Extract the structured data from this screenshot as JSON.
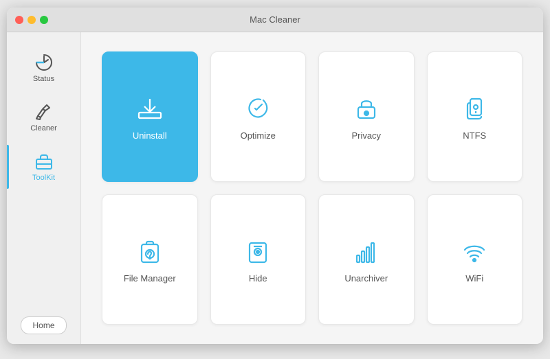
{
  "window": {
    "title": "Mac Cleaner"
  },
  "sidebar": {
    "items": [
      {
        "id": "status",
        "label": "Status",
        "active": false
      },
      {
        "id": "cleaner",
        "label": "Cleaner",
        "active": false
      },
      {
        "id": "toolkit",
        "label": "ToolKit",
        "active": true
      }
    ],
    "home_button": "Home"
  },
  "grid": {
    "tiles": [
      {
        "id": "uninstall",
        "label": "Uninstall",
        "active": true
      },
      {
        "id": "optimize",
        "label": "Optimize",
        "active": false
      },
      {
        "id": "privacy",
        "label": "Privacy",
        "active": false
      },
      {
        "id": "ntfs",
        "label": "NTFS",
        "active": false
      },
      {
        "id": "file-manager",
        "label": "File Manager",
        "active": false
      },
      {
        "id": "hide",
        "label": "Hide",
        "active": false
      },
      {
        "id": "unarchiver",
        "label": "Unarchiver",
        "active": false
      },
      {
        "id": "wifi",
        "label": "WiFi",
        "active": false
      }
    ]
  },
  "colors": {
    "accent": "#3db8e8",
    "icon_default": "#555555"
  }
}
